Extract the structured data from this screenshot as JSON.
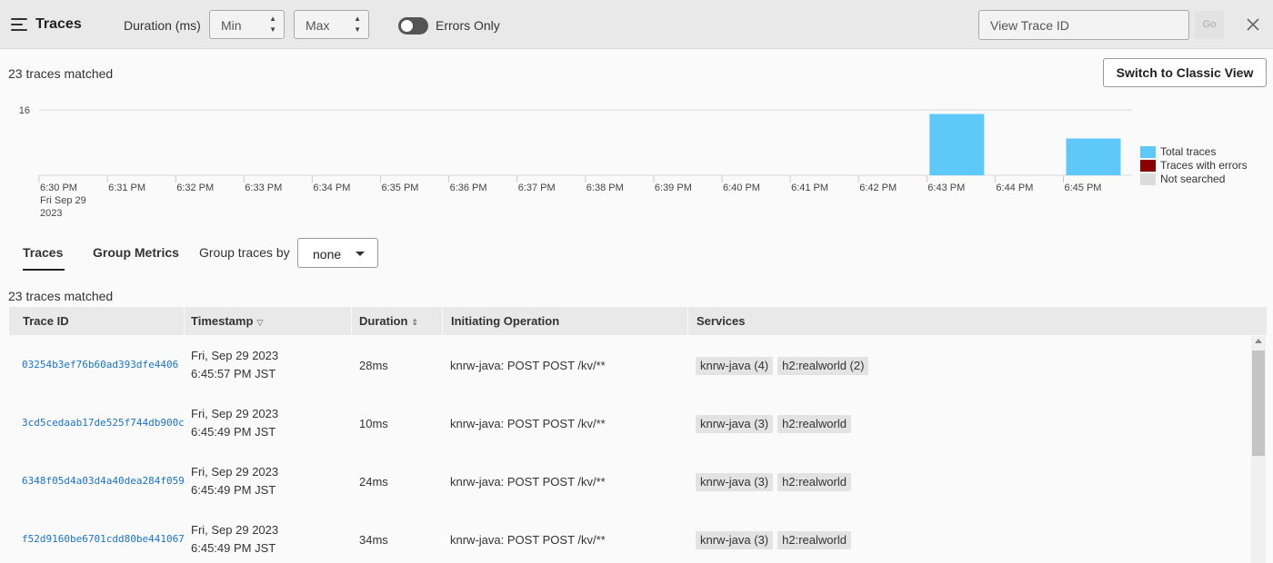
{
  "header": {
    "title": "Traces",
    "duration_label": "Duration (ms)",
    "min_placeholder": "Min",
    "max_placeholder": "Max",
    "errors_only_label": "Errors Only",
    "errors_only_on": false,
    "trace_id_placeholder": "View Trace ID",
    "go_label": "Go"
  },
  "summary": {
    "matched_text": "23 traces matched",
    "classic_view_label": "Switch to Classic View"
  },
  "chart_data": {
    "type": "bar",
    "categories": [
      "6:30 PM",
      "6:31 PM",
      "6:32 PM",
      "6:33 PM",
      "6:34 PM",
      "6:35 PM",
      "6:36 PM",
      "6:37 PM",
      "6:38 PM",
      "6:39 PM",
      "6:40 PM",
      "6:41 PM",
      "6:42 PM",
      "6:43 PM",
      "6:44 PM",
      "6:45 PM"
    ],
    "first_tick_sublabel": [
      "Fri Sep 29",
      "2023"
    ],
    "series": [
      {
        "name": "Total traces",
        "color": "#5ec8f8",
        "values": [
          0,
          0,
          0,
          0,
          0,
          0,
          0,
          0,
          0,
          0,
          0,
          0,
          0,
          15,
          0,
          9
        ]
      },
      {
        "name": "Traces with errors",
        "color": "#8b0000",
        "values": [
          0,
          0,
          0,
          0,
          0,
          0,
          0,
          0,
          0,
          0,
          0,
          0,
          0,
          0,
          0,
          0
        ]
      },
      {
        "name": "Not searched",
        "color": "#dcdcdc",
        "values": [
          0,
          0,
          0,
          0,
          0,
          0,
          0,
          0,
          0,
          0,
          0,
          0,
          0,
          0,
          0,
          0
        ]
      }
    ],
    "yticks": [
      "16"
    ],
    "ylim": [
      0,
      16
    ],
    "grid": true,
    "legend": "right"
  },
  "tabs": {
    "traces_label": "Traces",
    "group_metrics_label": "Group Metrics",
    "group_by_label": "Group traces by",
    "group_by_value": "none"
  },
  "table": {
    "matched_text": "23 traces matched",
    "headers": {
      "trace_id": "Trace ID",
      "timestamp": "Timestamp",
      "duration": "Duration",
      "initiating_operation": "Initiating Operation",
      "services": "Services"
    },
    "rows": [
      {
        "trace_id": "03254b3ef76b60ad393dfe4406",
        "date": "Fri, Sep 29 2023",
        "time": "6:45:57 PM JST",
        "duration": "28ms",
        "operation": "knrw-java: POST POST /kv/**",
        "services": [
          "knrw-java (4)",
          "h2:realworld (2)"
        ]
      },
      {
        "trace_id": "3cd5cedaab17de525f744db900c",
        "date": "Fri, Sep 29 2023",
        "time": "6:45:49 PM JST",
        "duration": "10ms",
        "operation": "knrw-java: POST POST /kv/**",
        "services": [
          "knrw-java (3)",
          "h2:realworld"
        ]
      },
      {
        "trace_id": "6348f05d4a03d4a40dea284f059",
        "date": "Fri, Sep 29 2023",
        "time": "6:45:49 PM JST",
        "duration": "24ms",
        "operation": "knrw-java: POST POST /kv/**",
        "services": [
          "knrw-java (3)",
          "h2:realworld"
        ]
      },
      {
        "trace_id": "f52d9160be6701cdd80be441067",
        "date": "Fri, Sep 29 2023",
        "time": "6:45:49 PM JST",
        "duration": "34ms",
        "operation": "knrw-java: POST POST /kv/**",
        "services": [
          "knrw-java (3)",
          "h2:realworld"
        ]
      }
    ]
  }
}
